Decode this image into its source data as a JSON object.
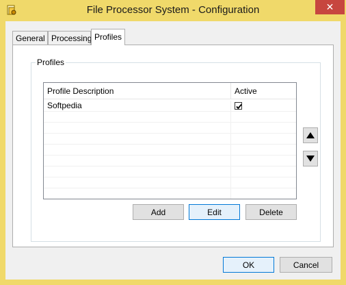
{
  "window": {
    "title": "File Processor System - Configuration",
    "close_label": "✕"
  },
  "tabs": [
    {
      "label": "General",
      "active": false
    },
    {
      "label": "Processing",
      "active": false
    },
    {
      "label": "Profiles",
      "active": true
    }
  ],
  "profiles_group": {
    "legend": "Profiles",
    "columns": [
      "Profile Description",
      "Active"
    ],
    "rows": [
      {
        "description": "Softpedia",
        "active": true
      }
    ],
    "move_up_icon": "triangle-up-icon",
    "move_down_icon": "triangle-down-icon"
  },
  "list_buttons": {
    "add": "Add",
    "edit": "Edit",
    "delete": "Delete"
  },
  "dialog_buttons": {
    "ok": "OK",
    "cancel": "Cancel"
  },
  "colors": {
    "titlebar": "#f0d96a",
    "close": "#c7463f",
    "focus": "#0078d7"
  }
}
